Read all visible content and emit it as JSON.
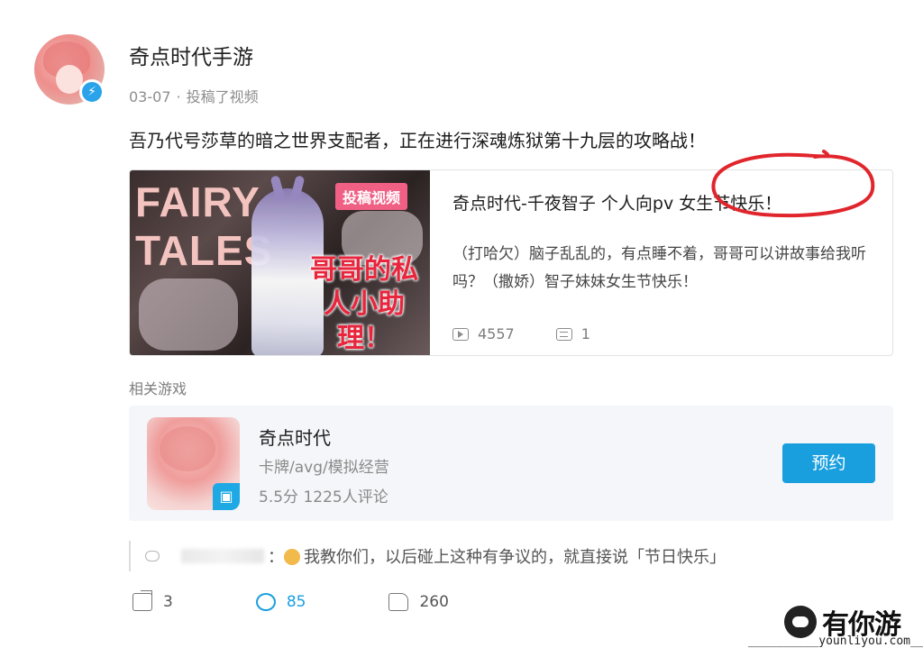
{
  "header": {
    "username": "奇点时代手游",
    "date": "03-07",
    "dot": "·",
    "action": "投稿了视频",
    "verified_icon": "lightning-icon"
  },
  "post": {
    "text": "吾乃代号莎草的暗之世界支配者，正在进行深魂炼狱第十九层的攻略战！"
  },
  "video": {
    "thumb_title": "FAIRY TALES",
    "thumb_tag": "投稿视频",
    "thumb_slogan": "哥哥的私人小助理！",
    "title": "奇点时代-千夜智子 个人向pv 女生节快乐！",
    "description": "（打哈欠）脑子乱乱的，有点睡不着，哥哥可以讲故事给我听吗？（撒娇）智子妹妹女生节快乐！",
    "plays": "4557",
    "comments": "1",
    "highlight_color": "#e0262c"
  },
  "related": {
    "label": "相关游戏",
    "game": {
      "name": "奇点时代",
      "genre": "卡牌/avg/模拟经营",
      "rating": "5.5分 1225人评论",
      "button": "预约",
      "badge_icon": "tv-icon"
    }
  },
  "comment_preview": {
    "separator": "：",
    "text": "我教你们，以后碰上这种有争议的，就直接说「节日快乐」"
  },
  "actions": {
    "shares": "3",
    "replies": "85",
    "likes": "260"
  },
  "watermark": {
    "text": "有你游",
    "url": "__________younliyou.com__"
  },
  "colors": {
    "accent": "#1a9fde",
    "tag_pink": "#f05f84",
    "annotation_red": "#e0262c"
  }
}
